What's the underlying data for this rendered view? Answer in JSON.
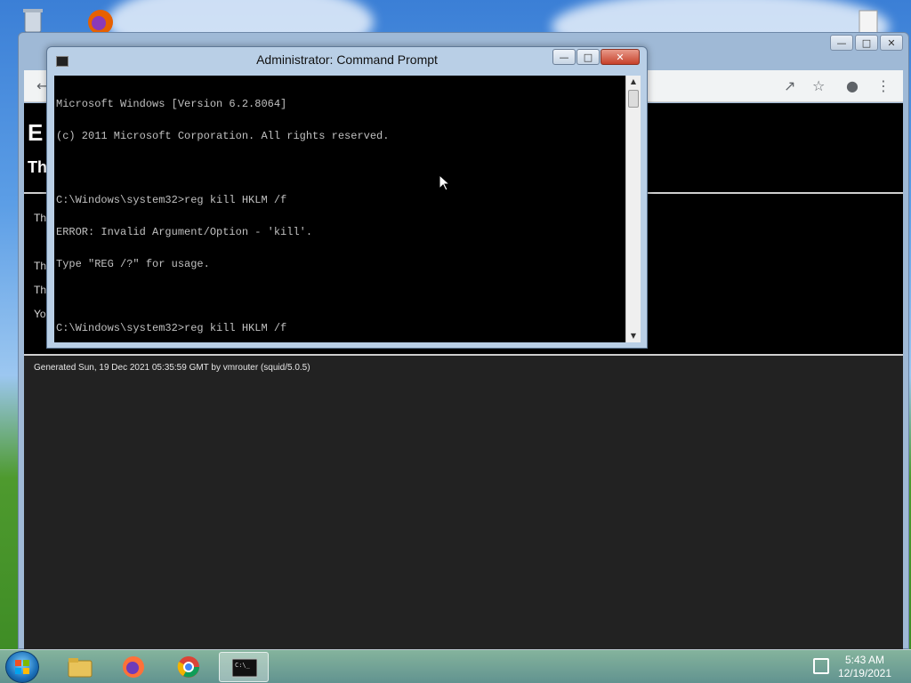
{
  "browser": {
    "page_title": "E",
    "page_subtitle": "Th",
    "body_lines": [
      "Th",
      "Th",
      "Th",
      "Yo"
    ],
    "footer": "Generated Sun, 19 Dec 2021 05:35:59 GMT by vmrouter (squid/5.0.5)"
  },
  "cmd": {
    "title": "Administrator: Command Prompt",
    "lines": [
      "Microsoft Windows [Version 6.2.8064]",
      "(c) 2011 Microsoft Corporation. All rights reserved.",
      "",
      "C:\\Windows\\system32>reg kill HKLM /f",
      "ERROR: Invalid Argument/Option - 'kill'.",
      "Type \"REG /?\" for usage.",
      "",
      "C:\\Windows\\system32>reg kill HKLM /f"
    ]
  },
  "taskbar": {
    "apps": [
      "file-explorer-icon",
      "firefox-icon",
      "chrome-icon",
      "command-prompt-icon"
    ],
    "active_app": "command-prompt-icon",
    "time": "5:43 AM",
    "date": "12/19/2021"
  }
}
